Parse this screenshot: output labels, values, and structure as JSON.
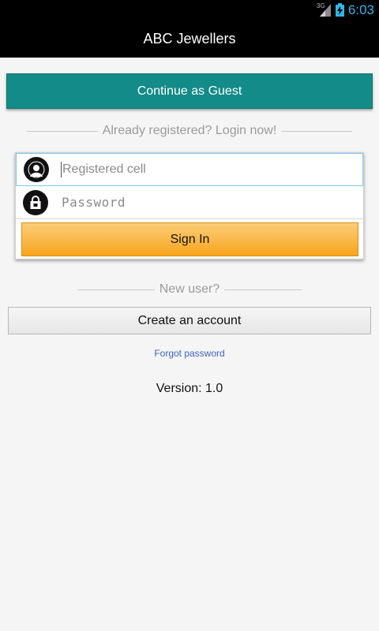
{
  "status_bar": {
    "network": "3G",
    "time": "6:03",
    "time_color": "#33b5e5"
  },
  "app": {
    "title": "ABC Jewellers"
  },
  "guest": {
    "label": "Continue as Guest",
    "color": "#138b88"
  },
  "login": {
    "divider_text": "Already registered? Login now!",
    "cell_placeholder": "Registered cell",
    "cell_value": "",
    "password_placeholder": "Password",
    "password_value": "",
    "sign_in_label": "Sign In",
    "sign_in_color": "#f7a51c"
  },
  "register": {
    "divider_text": "New user?",
    "create_label": "Create an account"
  },
  "forgot_label": "Forgot password",
  "version_text": "Version: 1.0"
}
